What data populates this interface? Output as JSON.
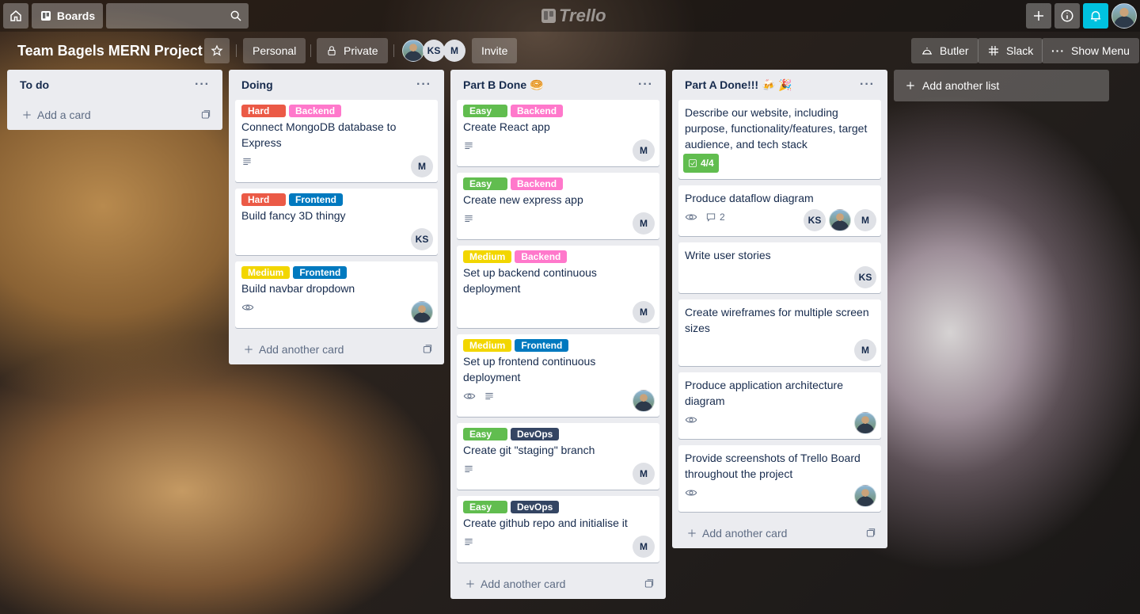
{
  "header": {
    "boards_label": "Boards",
    "search_placeholder": "",
    "logo_text": "Trello"
  },
  "board": {
    "title": "Team Bagels MERN Project",
    "visibility_team": "Personal",
    "visibility": "Private",
    "members": [
      "photo",
      "KS",
      "M"
    ],
    "invite_label": "Invite",
    "butler_label": "Butler",
    "slack_label": "Slack",
    "menu_label": "Show Menu",
    "add_list_label": "Add another list"
  },
  "colors": {
    "hard": "#eb5a46",
    "backend": "#ff78cb",
    "frontend": "#0079bf",
    "medium": "#f2d600",
    "easy": "#61bd4f",
    "devops": "#344563"
  },
  "lists": [
    {
      "title": "To do",
      "add_label": "Add a card",
      "cards": []
    },
    {
      "title": "Doing",
      "add_label": "Add another card",
      "cards": [
        {
          "labels": [
            {
              "text": "Hard",
              "color": "#eb5a46"
            },
            {
              "text": "Backend",
              "color": "#ff78cb"
            }
          ],
          "title": "Connect MongoDB database to Express",
          "badges": [
            "description"
          ],
          "members": [
            "M"
          ]
        },
        {
          "labels": [
            {
              "text": "Hard",
              "color": "#eb5a46"
            },
            {
              "text": "Frontend",
              "color": "#0079bf"
            }
          ],
          "title": "Build fancy 3D thingy",
          "badges": [],
          "members": [
            "KS"
          ]
        },
        {
          "labels": [
            {
              "text": "Medium",
              "color": "#f2d600"
            },
            {
              "text": "Frontend",
              "color": "#0079bf"
            }
          ],
          "title": "Build navbar dropdown",
          "badges": [
            "watch"
          ],
          "members": [
            "photo"
          ]
        }
      ]
    },
    {
      "title": "Part B Done 🥯",
      "add_label": "Add another card",
      "cards": [
        {
          "labels": [
            {
              "text": "Easy",
              "color": "#61bd4f"
            },
            {
              "text": "Backend",
              "color": "#ff78cb"
            }
          ],
          "title": "Create React app",
          "badges": [
            "description"
          ],
          "members": [
            "M"
          ]
        },
        {
          "labels": [
            {
              "text": "Easy",
              "color": "#61bd4f"
            },
            {
              "text": "Backend",
              "color": "#ff78cb"
            }
          ],
          "title": "Create new express app",
          "badges": [
            "description"
          ],
          "members": [
            "M"
          ]
        },
        {
          "labels": [
            {
              "text": "Medium",
              "color": "#f2d600"
            },
            {
              "text": "Backend",
              "color": "#ff78cb"
            }
          ],
          "title": "Set up backend continuous deployment",
          "badges": [],
          "members": [
            "M"
          ]
        },
        {
          "labels": [
            {
              "text": "Medium",
              "color": "#f2d600"
            },
            {
              "text": "Frontend",
              "color": "#0079bf"
            }
          ],
          "title": "Set up frontend continuous deployment",
          "badges": [
            "watch",
            "description"
          ],
          "members": [
            "photo"
          ]
        },
        {
          "labels": [
            {
              "text": "Easy",
              "color": "#61bd4f"
            },
            {
              "text": "DevOps",
              "color": "#344563"
            }
          ],
          "title": "Create git \"staging\" branch",
          "badges": [
            "description"
          ],
          "members": [
            "M"
          ]
        },
        {
          "labels": [
            {
              "text": "Easy",
              "color": "#61bd4f"
            },
            {
              "text": "DevOps",
              "color": "#344563"
            }
          ],
          "title": "Create github repo and initialise it",
          "badges": [
            "description"
          ],
          "members": [
            "M"
          ]
        }
      ]
    },
    {
      "title": "Part A Done!!! 🍻 🎉",
      "add_label": "Add another card",
      "cards": [
        {
          "labels": [],
          "title": "Describe our website, including purpose, functionality/features, target audience, and tech stack",
          "badges": [
            "checklist"
          ],
          "checklist": "4/4",
          "members": []
        },
        {
          "labels": [],
          "title": "Produce dataflow diagram",
          "badges": [
            "watch",
            "comments"
          ],
          "comments": "2",
          "members": [
            "KS",
            "photo",
            "M"
          ]
        },
        {
          "labels": [],
          "title": "Write user stories",
          "badges": [],
          "members": [
            "KS"
          ]
        },
        {
          "labels": [],
          "title": "Create wireframes for multiple screen sizes",
          "badges": [],
          "members": [
            "M"
          ]
        },
        {
          "labels": [],
          "title": "Produce application architecture diagram",
          "badges": [
            "watch"
          ],
          "members": [
            "photo"
          ]
        },
        {
          "labels": [],
          "title": "Provide screenshots of Trello Board throughout the project",
          "badges": [
            "watch"
          ],
          "members": [
            "photo"
          ]
        }
      ]
    }
  ]
}
